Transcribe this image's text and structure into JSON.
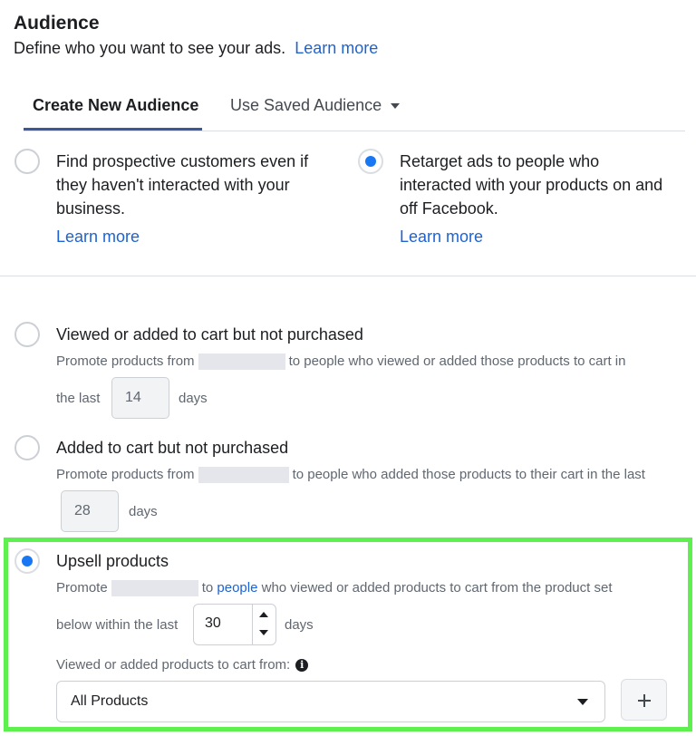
{
  "header": {
    "title": "Audience",
    "subtitle": "Define who you want to see your ads.",
    "learn_more": "Learn more"
  },
  "tabs": [
    {
      "label": "Create New Audience",
      "active": true
    },
    {
      "label": "Use Saved Audience",
      "active": false,
      "icon": "caret-down-icon"
    }
  ],
  "audience_type": {
    "options": [
      {
        "text": "Find prospective customers even if they haven't interacted with your business.",
        "link": "Learn more",
        "checked": false
      },
      {
        "text": "Retarget ads to people who interacted with your products on and off Facebook.",
        "link": "Learn more",
        "checked": true
      }
    ]
  },
  "retarget_options": [
    {
      "label": "Viewed or added to cart but not purchased",
      "checked": false,
      "desc_start": "Promote products from",
      "desc_end": "to people who viewed or added those products to cart in",
      "desc_line2": "the last",
      "days": "14",
      "days_label": "days"
    },
    {
      "label": "Added to cart but not purchased",
      "checked": false,
      "desc_start": "Promote products from",
      "desc_end": "to people who added those products to their cart in the last",
      "days": "28",
      "days_label": "days"
    },
    {
      "label": "Upsell products",
      "checked": true,
      "desc_start": "Promote",
      "desc_to": "to",
      "desc_link": "people",
      "desc_end": "who viewed or added products to cart from the product set",
      "desc_line2": "below within the last",
      "days": "30",
      "days_label": "days",
      "product_label": "Viewed or added products to cart from:",
      "product_select": "All Products"
    }
  ],
  "colors": {
    "accent": "#1877f2",
    "link": "#1d63d1",
    "tab_underline": "#3b5998",
    "highlight": "#5ef04f"
  }
}
